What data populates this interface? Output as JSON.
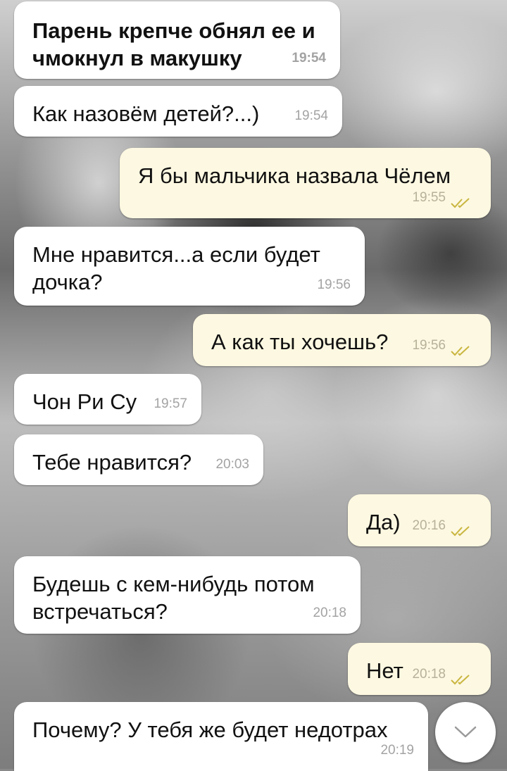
{
  "messages": [
    {
      "id": "m1",
      "direction": "incoming",
      "text": "Парень крепче обнял ее и чмокнул в макушку",
      "time": "19:54"
    },
    {
      "id": "m2",
      "direction": "incoming",
      "text": "Как назовём детей?...)",
      "time": "19:54"
    },
    {
      "id": "m3",
      "direction": "outgoing",
      "text": "Я бы мальчика назвала Чёлем",
      "time": "19:55",
      "status": "read"
    },
    {
      "id": "m4",
      "direction": "incoming",
      "text": "Мне нравится...а если будет дочка?",
      "time": "19:56"
    },
    {
      "id": "m5",
      "direction": "outgoing",
      "text": "А как ты хочешь?",
      "time": "19:56",
      "status": "read"
    },
    {
      "id": "m6",
      "direction": "incoming",
      "text": "Чон Ри Су",
      "time": "19:57"
    },
    {
      "id": "m7",
      "direction": "incoming",
      "text": "Тебе нравится?",
      "time": "20:03"
    },
    {
      "id": "m8",
      "direction": "outgoing",
      "text": "Да)",
      "time": "20:16",
      "status": "read"
    },
    {
      "id": "m9",
      "direction": "incoming",
      "text": "Будешь с кем-нибудь потом встречаться?",
      "time": "20:18"
    },
    {
      "id": "m10",
      "direction": "outgoing",
      "text": "Нет",
      "time": "20:18",
      "status": "read"
    },
    {
      "id": "m11",
      "direction": "incoming",
      "text": "Почему? У тебя же будет недотрах",
      "time": "20:19"
    }
  ],
  "scroll_button": {
    "icon": "chevron-down-icon"
  },
  "colors": {
    "incoming_bubble": "#ffffff",
    "outgoing_bubble": "#fdf8e1",
    "read_check": "#c9b640"
  }
}
